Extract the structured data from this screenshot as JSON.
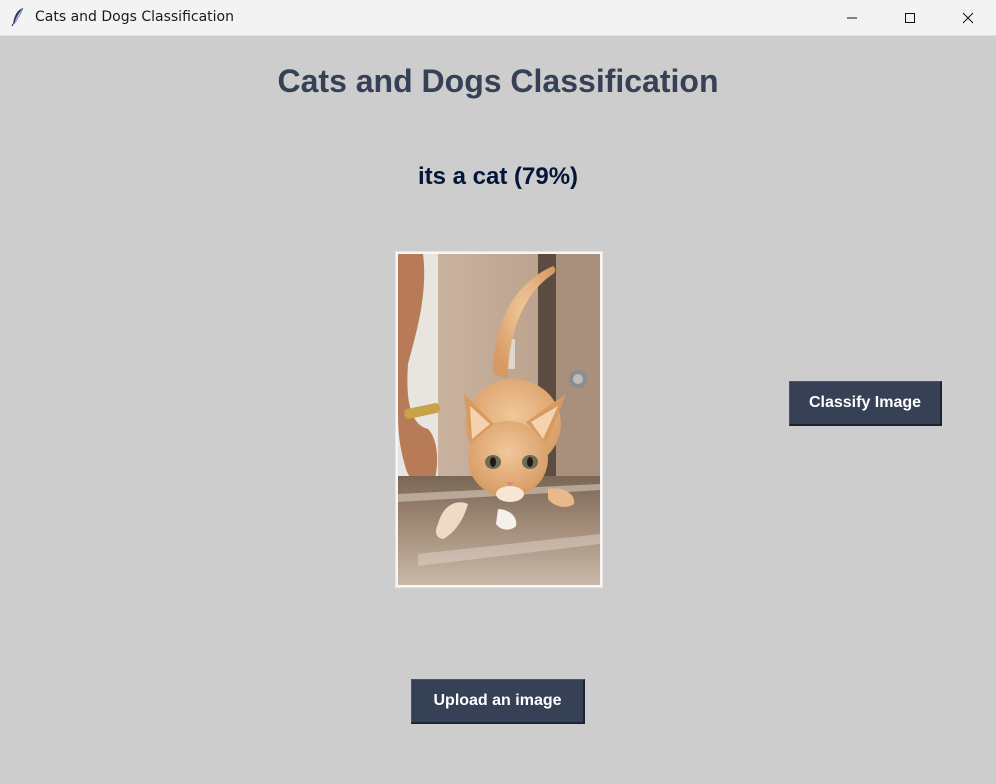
{
  "window": {
    "title": "Cats and Dogs Classification",
    "app_icon": "feather-icon",
    "controls": [
      "minimize-icon",
      "maximize-icon",
      "close-icon"
    ]
  },
  "main": {
    "title": "Cats and Dogs Classification",
    "result_text": "its a cat (79%)",
    "image": {
      "subject": "orange kitten walking on a metal table",
      "icon": "photo"
    },
    "classify_button_label": "Classify Image",
    "upload_button_label": "Upload an image"
  },
  "colors": {
    "background": "#cdcdcd",
    "title": "#364156",
    "result": "#011638",
    "button_bg": "#364156",
    "button_text": "#ffffff",
    "titlebar": "#f3f3f3"
  }
}
